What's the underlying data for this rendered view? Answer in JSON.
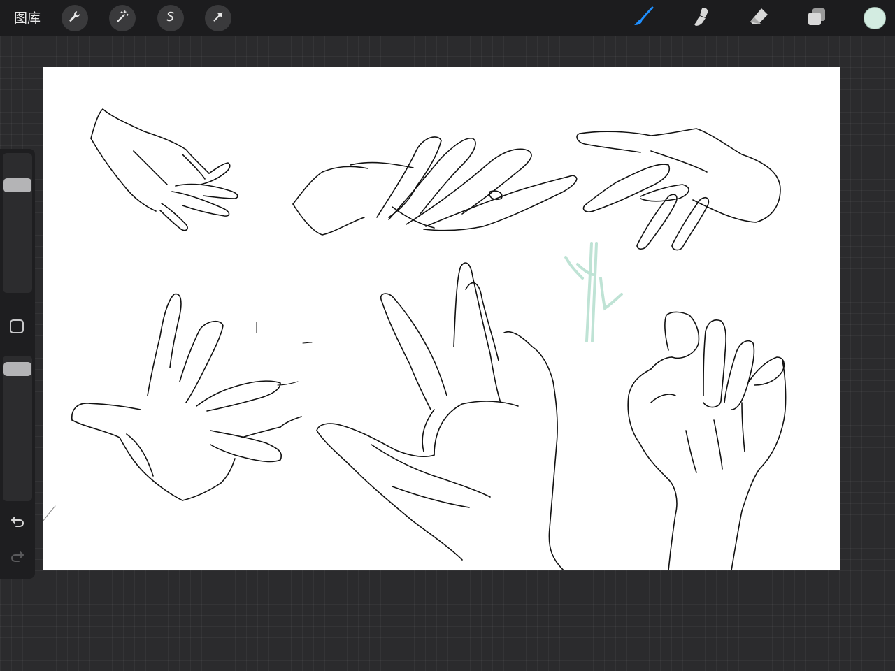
{
  "topbar": {
    "gallery_label": "图库",
    "left_tools": [
      {
        "name": "actions",
        "icon": "wrench-icon"
      },
      {
        "name": "adjustments",
        "icon": "magic-wand-icon"
      },
      {
        "name": "selection",
        "icon": "selection-s-icon"
      },
      {
        "name": "transform",
        "icon": "arrow-cursor-icon"
      }
    ],
    "right_tools": [
      {
        "name": "brush",
        "icon": "brush-icon",
        "active": true
      },
      {
        "name": "smudge",
        "icon": "smudge-finger-icon"
      },
      {
        "name": "eraser",
        "icon": "eraser-icon"
      },
      {
        "name": "layers",
        "icon": "layers-icon"
      }
    ],
    "current_color": "#d3ece1"
  },
  "sidebar": {
    "brush_size_level": 0.8,
    "opacity_level": 0.95,
    "controls": [
      "brush-size-slider",
      "modify-button",
      "opacity-slider",
      "undo-button",
      "redo-button"
    ]
  },
  "colors": {
    "accent": "#1f8fff",
    "toolbar_bg": "#1c1c1e",
    "workspace_bg": "#2b2b2d",
    "canvas_bg": "#ffffff",
    "sketch_stroke": "#111111",
    "mint_stroke": "#bfe3d5"
  },
  "canvas": {
    "content": "hand-sketches"
  }
}
